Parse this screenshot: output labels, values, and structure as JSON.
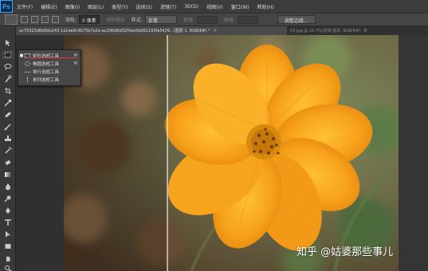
{
  "app": {
    "logo": "Ps"
  },
  "menu": [
    "文件(F)",
    "编辑(E)",
    "图像(I)",
    "图层(L)",
    "类型(Y)",
    "选择(S)",
    "滤镜(T)",
    "3D(D)",
    "视图(V)",
    "窗口(W)",
    "帮助(H)"
  ],
  "options": {
    "feather_label": "羽化:",
    "feather_value": "0 像素",
    "antialias_label": "消除锯齿",
    "style_label": "样式:",
    "style_value": "正常",
    "width_label": "宽度:",
    "height_label": "高度:",
    "refine_button": "调整边缘..."
  },
  "tabs": [
    {
      "label": "ac75323d6b6de243-1a1ee6c9b75b7e2e-ac290d6d32f0ae5dd61193fe5429...(图层 1, RGB/8#) *",
      "active": true,
      "close": "×"
    },
    {
      "label": "03.jpg @ 16.7%(背景 副本, RGB/8#)",
      "active": false,
      "close": "×"
    }
  ],
  "tool_icons": [
    "move-icon",
    "marquee-icon",
    "lasso-icon",
    "quick-select-icon",
    "crop-icon",
    "eyedropper-icon",
    "healing-icon",
    "brush-icon",
    "stamp-icon",
    "history-brush-icon",
    "eraser-icon",
    "gradient-icon",
    "blur-icon",
    "dodge-icon",
    "pen-icon",
    "type-icon",
    "path-select-icon",
    "shape-icon",
    "hand-icon",
    "zoom-icon"
  ],
  "flyout": [
    {
      "label": "矩形选框工具",
      "key": "M",
      "icon": "rect-marquee-icon",
      "selected": true
    },
    {
      "label": "椭圆选框工具",
      "key": "M",
      "icon": "ellipse-marquee-icon",
      "selected": false
    },
    {
      "label": "单行选框工具",
      "key": "",
      "icon": "row-marquee-icon",
      "selected": false
    },
    {
      "label": "单列选框工具",
      "key": "",
      "icon": "column-marquee-icon",
      "selected": false
    }
  ],
  "watermark": "知乎 @姑婆那些事儿",
  "colors": {
    "accent_underline": "#e03b3b",
    "petal": "#f7a21b",
    "center": "#d88a0c",
    "background": "#282828"
  }
}
